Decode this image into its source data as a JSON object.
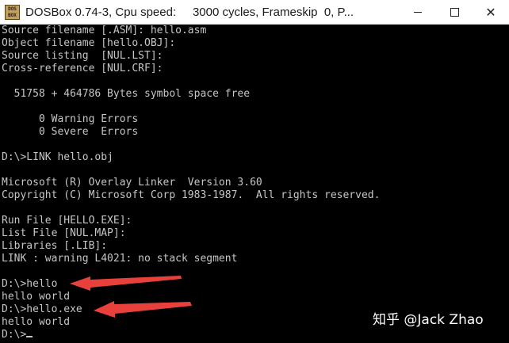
{
  "window": {
    "title": "DOSBox 0.74-3, Cpu speed:     3000 cycles, Frameskip  0, P...",
    "icon_name": "dosbox-icon",
    "icon_text": "DOS BOX",
    "buttons": {
      "minimize_icon": "minimize-icon",
      "maximize_icon": "maximize-icon",
      "close_icon": "close-icon",
      "close_glyph": "✕"
    }
  },
  "console": {
    "lines": [
      "Source filename [.ASM]: hello.asm",
      "Object filename [hello.OBJ]:",
      "Source listing  [NUL.LST]:",
      "Cross-reference [NUL.CRF]:",
      "",
      "  51758 + 464786 Bytes symbol space free",
      "",
      "      0 Warning Errors",
      "      0 Severe  Errors",
      "",
      "D:\\>LINK hello.obj",
      "",
      "Microsoft (R) Overlay Linker  Version 3.60",
      "Copyright (C) Microsoft Corp 1983-1987.  All rights reserved.",
      "",
      "Run File [HELLO.EXE]:",
      "List File [NUL.MAP]:",
      "Libraries [.LIB]:",
      "LINK : warning L4021: no stack segment",
      "",
      "D:\\>hello",
      "hello world",
      "D:\\>hello.exe",
      "hello world",
      "D:\\>"
    ],
    "text_color": "#c6c6c6",
    "background_color": "#000000"
  },
  "annotations": {
    "arrow_color": "#e8413c",
    "arrows": [
      "red-arrow-pointing-at-hello",
      "red-arrow-pointing-at-hello-exe"
    ]
  },
  "watermark": {
    "text": "知乎 @Jack Zhao"
  }
}
